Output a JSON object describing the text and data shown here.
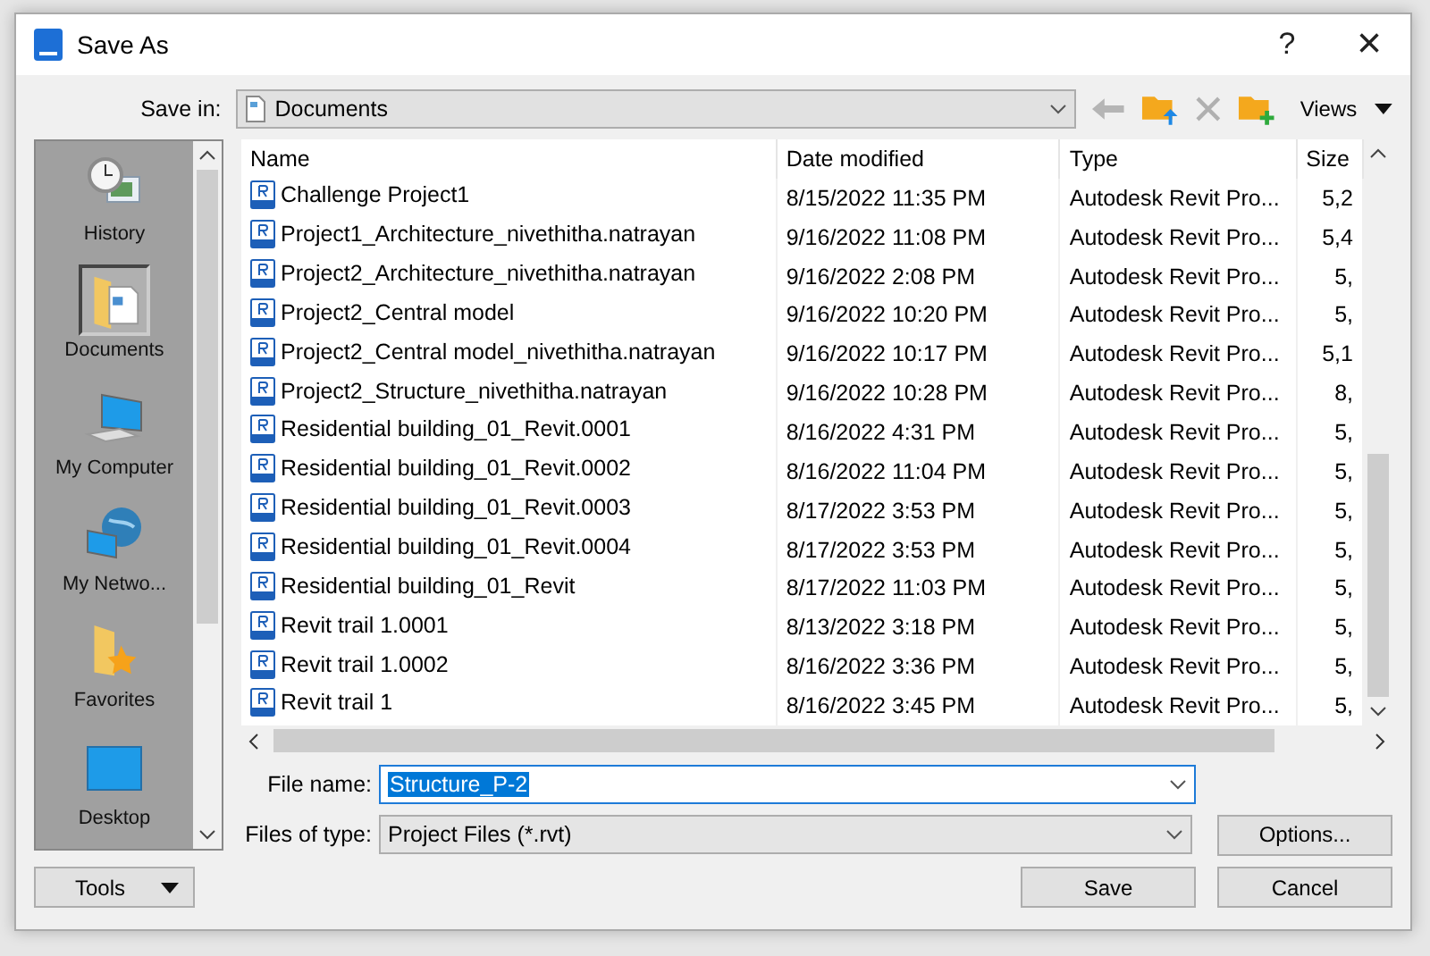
{
  "window": {
    "title": "Save As",
    "help": "?",
    "close": "×"
  },
  "save_in": {
    "label": "Save in:",
    "value": "Documents"
  },
  "toolbar": {
    "views": "Views"
  },
  "places": [
    {
      "label": "History",
      "kind": "history",
      "selected": false
    },
    {
      "label": "Documents",
      "kind": "documents",
      "selected": true
    },
    {
      "label": "My Computer",
      "kind": "computer",
      "selected": false
    },
    {
      "label": "My Netwo...",
      "kind": "network",
      "selected": false
    },
    {
      "label": "Favorites",
      "kind": "favorites",
      "selected": false
    },
    {
      "label": "Desktop",
      "kind": "desktop",
      "selected": false
    }
  ],
  "table": {
    "columns": [
      "Name",
      "Date modified",
      "Type",
      "Size"
    ],
    "rows": [
      [
        "Challenge Project1",
        "8/15/2022 11:35 PM",
        "Autodesk Revit Pro...",
        "5,2"
      ],
      [
        "Project1_Architecture_nivethitha.natrayan",
        "9/16/2022 11:08 PM",
        "Autodesk Revit Pro...",
        "5,4"
      ],
      [
        "Project2_Architecture_nivethitha.natrayan",
        "9/16/2022 2:08 PM",
        "Autodesk Revit Pro...",
        "5,"
      ],
      [
        "Project2_Central model",
        "9/16/2022 10:20 PM",
        "Autodesk Revit Pro...",
        "5,"
      ],
      [
        "Project2_Central model_nivethitha.natrayan",
        "9/16/2022 10:17 PM",
        "Autodesk Revit Pro...",
        "5,1"
      ],
      [
        "Project2_Structure_nivethitha.natrayan",
        "9/16/2022 10:28 PM",
        "Autodesk Revit Pro...",
        "8,"
      ],
      [
        "Residential building_01_Revit.0001",
        "8/16/2022 4:31 PM",
        "Autodesk Revit Pro...",
        "5,"
      ],
      [
        "Residential building_01_Revit.0002",
        "8/16/2022 11:04 PM",
        "Autodesk Revit Pro...",
        "5,"
      ],
      [
        "Residential building_01_Revit.0003",
        "8/17/2022 3:53 PM",
        "Autodesk Revit Pro...",
        "5,"
      ],
      [
        "Residential building_01_Revit.0004",
        "8/17/2022 3:53 PM",
        "Autodesk Revit Pro...",
        "5,"
      ],
      [
        "Residential building_01_Revit",
        "8/17/2022 11:03 PM",
        "Autodesk Revit Pro...",
        "5,"
      ],
      [
        "Revit trail 1.0001",
        "8/13/2022 3:18 PM",
        "Autodesk Revit Pro...",
        "5,"
      ],
      [
        "Revit trail 1.0002",
        "8/16/2022 3:36 PM",
        "Autodesk Revit Pro...",
        "5,"
      ],
      [
        "Revit trail 1",
        "8/16/2022 3:45 PM",
        "Autodesk Revit Pro...",
        "5,"
      ]
    ]
  },
  "file_name": {
    "label": "File name:",
    "value": "Structure_P-2"
  },
  "file_type": {
    "label": "Files of type:",
    "value": "Project Files  (*.rvt)"
  },
  "buttons": {
    "tools": "Tools",
    "options": "Options...",
    "save": "Save",
    "cancel": "Cancel"
  }
}
